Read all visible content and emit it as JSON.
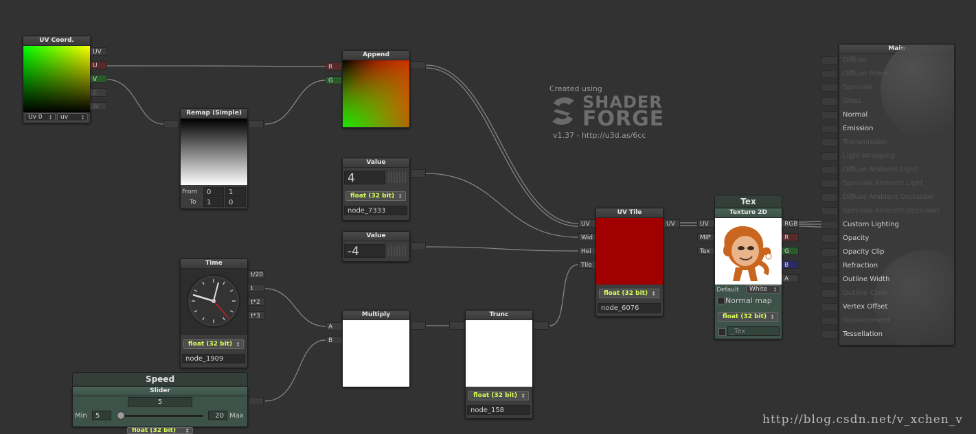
{
  "watermark": {
    "created_using": "Created using",
    "shader": "SHADER",
    "forge": "FORGE",
    "version": "v1.37 - http://u3d.as/6cc"
  },
  "footer_url": "http://blog.csdn.net/v_xchen_v",
  "nodes": {
    "uv_coord": {
      "title": "UV Coord.",
      "ports": [
        "UV",
        "U",
        "V",
        "Z",
        "W"
      ],
      "uv_channel": "Uv 0",
      "uv_mode": "uv"
    },
    "remap": {
      "title": "Remap (Simple)",
      "from_label": "From",
      "to_label": "To",
      "from_min": "0",
      "from_max": "1",
      "to_min": "1",
      "to_max": "0"
    },
    "append": {
      "title": "Append",
      "ports": [
        "R",
        "G"
      ]
    },
    "value1": {
      "title": "Value",
      "value": "4",
      "precision": "float (32 bit)",
      "name": "node_7333"
    },
    "value2": {
      "title": "Value",
      "value": "-4"
    },
    "time": {
      "title": "Time",
      "ports": [
        "t/20",
        "t",
        "t*2",
        "t*3"
      ],
      "precision": "float (32 bit)",
      "name": "node_1909"
    },
    "speed": {
      "group": "Speed",
      "title": "Slider",
      "value": "5",
      "min_label": "Min",
      "min": "5",
      "max": "20",
      "max_label": "Max",
      "precision": "float (32 bit)"
    },
    "multiply": {
      "title": "Multiply",
      "ports": [
        "A",
        "B"
      ]
    },
    "trunc": {
      "title": "Trunc",
      "precision": "float (32 bit)",
      "name": "node_158"
    },
    "uvtile": {
      "title": "UV Tile",
      "ports": [
        "UV",
        "Wid",
        "Hei",
        "Tile"
      ],
      "out": "UV",
      "precision": "float (32 bit)",
      "name": "node_6076"
    },
    "tex": {
      "group": "Tex",
      "title": "Texture 2D",
      "in_ports": [
        "UV",
        "MIP",
        "Tex"
      ],
      "out_ports": [
        "RGB",
        "R",
        "G",
        "B",
        "A"
      ],
      "default_label": "Default",
      "default_value": "White",
      "normal_map": "Normal map",
      "precision": "float (32 bit)",
      "name": "_Tex"
    }
  },
  "main": {
    "title": "Main",
    "inputs": [
      {
        "label": "Diffuse",
        "enabled": false
      },
      {
        "label": "Diffuse Power",
        "enabled": false
      },
      {
        "label": "Specular",
        "enabled": false
      },
      {
        "label": "Gloss",
        "enabled": false
      },
      {
        "label": "Normal",
        "enabled": true
      },
      {
        "label": "Emission",
        "enabled": true
      },
      {
        "label": "Transmission",
        "enabled": false
      },
      {
        "label": "Light Wrapping",
        "enabled": false
      },
      {
        "label": "Diffuse Ambient Light",
        "enabled": false
      },
      {
        "label": "Specular Ambient Light",
        "enabled": false
      },
      {
        "label": "Diffuse Ambient Occlusion",
        "enabled": false
      },
      {
        "label": "Specular Ambient Occlusion",
        "enabled": false
      },
      {
        "label": "Custom Lighting",
        "enabled": true
      },
      {
        "label": "Opacity",
        "enabled": true
      },
      {
        "label": "Opacity Clip",
        "enabled": true
      },
      {
        "label": "Refraction",
        "enabled": true
      },
      {
        "label": "Outline Width",
        "enabled": true
      },
      {
        "label": "Outline Color",
        "enabled": false
      },
      {
        "label": "Vertex Offset",
        "enabled": true
      },
      {
        "label": "Displacement",
        "enabled": false
      },
      {
        "label": "Tessellation",
        "enabled": true
      }
    ]
  },
  "colors": {
    "canvas": "#323232",
    "wire": "#8a8a8a",
    "uvtile_preview": "#a00000",
    "float_label": "#d8ff5a"
  }
}
